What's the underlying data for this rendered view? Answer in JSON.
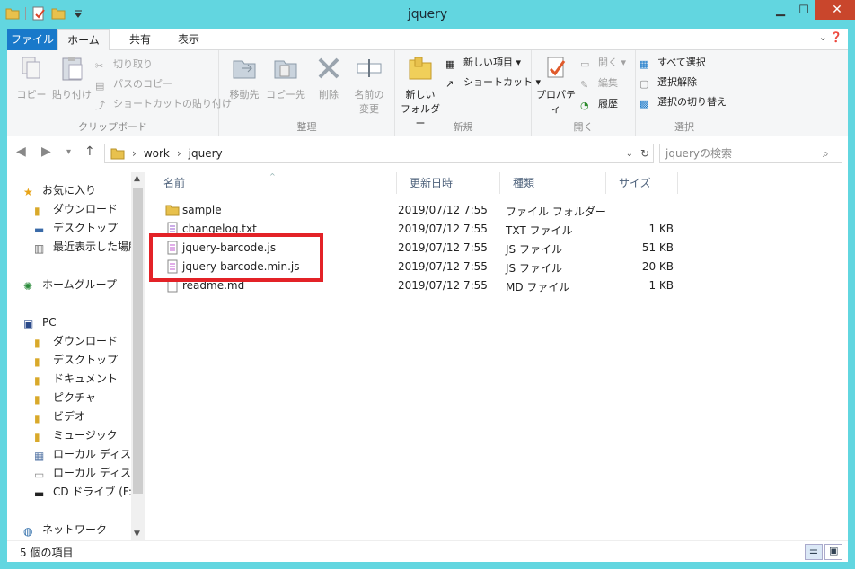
{
  "window": {
    "title": "jquery"
  },
  "tabs": {
    "file": "ファイル",
    "home": "ホーム",
    "share": "共有",
    "view": "表示"
  },
  "ribbon": {
    "clipboard": {
      "name": "クリップボード",
      "copy": "コピー",
      "paste": "貼り付け",
      "cut": "切り取り",
      "copy_path": "パスのコピー",
      "paste_shortcut": "ショートカットの貼り付け"
    },
    "organize": {
      "name": "整理",
      "move_to": "移動先",
      "copy_to": "コピー先",
      "delete": "削除",
      "rename_1": "名前の",
      "rename_2": "変更"
    },
    "new": {
      "name": "新規",
      "new_folder_1": "新しい",
      "new_folder_2": "フォルダー",
      "new_item": "新しい項目 ▾",
      "easy_access": "ショートカット ▾"
    },
    "open": {
      "name": "開く",
      "properties": "プロパティ",
      "open": "開く ▾",
      "edit": "編集",
      "history": "履歴"
    },
    "select": {
      "name": "選択",
      "select_all": "すべて選択",
      "select_none": "選択解除",
      "invert": "選択の切り替え"
    }
  },
  "address": {
    "crumbs": [
      "work",
      "jquery"
    ],
    "search_placeholder": "jqueryの検索"
  },
  "nav": {
    "favorites": "お気に入り",
    "fav_items": [
      "ダウンロード",
      "デスクトップ",
      "最近表示した場所"
    ],
    "homegroup": "ホームグループ",
    "pc": "PC",
    "pc_items": [
      "ダウンロード",
      "デスクトップ",
      "ドキュメント",
      "ピクチャ",
      "ビデオ",
      "ミュージック",
      "ローカル ディスク (",
      "ローカル ディスク (",
      "CD ドライブ (F:)"
    ],
    "network": "ネットワーク"
  },
  "columns": {
    "name": "名前",
    "date": "更新日時",
    "type": "種類",
    "size": "サイズ"
  },
  "files": [
    {
      "name": "sample",
      "date": "2019/07/12 7:55",
      "type": "ファイル フォルダー",
      "size": "",
      "icon": "folder-icon"
    },
    {
      "name": "changelog.txt",
      "date": "2019/07/12 7:55",
      "type": "TXT ファイル",
      "size": "1 KB",
      "icon": "text-file-icon"
    },
    {
      "name": "jquery-barcode.js",
      "date": "2019/07/12 7:55",
      "type": "JS ファイル",
      "size": "51 KB",
      "icon": "js-file-icon"
    },
    {
      "name": "jquery-barcode.min.js",
      "date": "2019/07/12 7:55",
      "type": "JS ファイル",
      "size": "20 KB",
      "icon": "js-file-icon"
    },
    {
      "name": "readme.md",
      "date": "2019/07/12 7:55",
      "type": "MD ファイル",
      "size": "1 KB",
      "icon": "blank-file-icon"
    }
  ],
  "status": {
    "count": "5 個の項目"
  },
  "colors": {
    "frame": "#62d6e0",
    "file_tab": "#1979ca",
    "close": "#c9462c",
    "highlight": "#e32227"
  }
}
